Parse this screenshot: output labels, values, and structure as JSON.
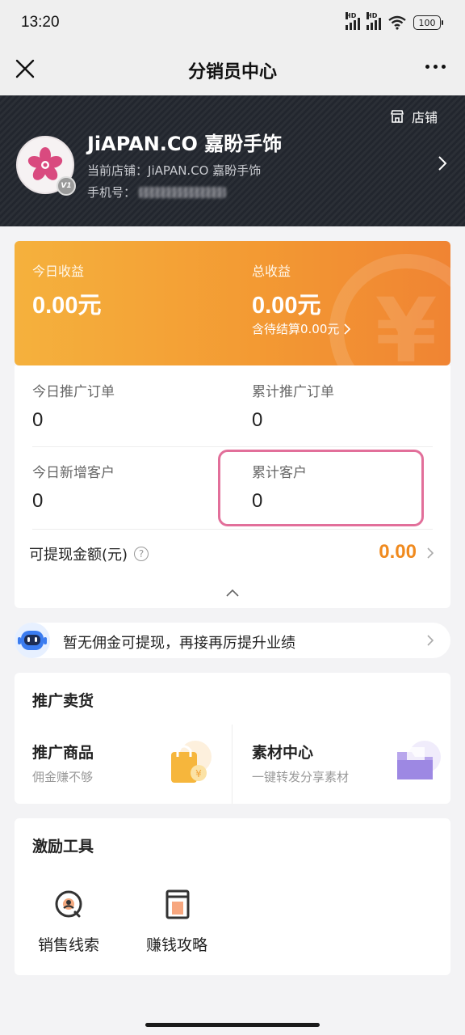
{
  "status_bar": {
    "time": "13:20",
    "signal1_label": "HD",
    "signal2_label": "HD",
    "battery": "100"
  },
  "nav": {
    "title": "分销员中心",
    "close_icon": "close-icon",
    "more_icon": "more-icon"
  },
  "profile": {
    "shop_link_label": "店铺",
    "name": "JiAPAN.CO 嘉盼手饰",
    "level_badge": "V1",
    "current_shop_label": "当前店铺：",
    "current_shop_name": "JiAPAN.CO 嘉盼手饰",
    "phone_label": "手机号："
  },
  "earnings": {
    "today_label": "今日收益",
    "today_value": "0.00元",
    "total_label": "总收益",
    "total_value": "0.00元",
    "pending_text": "含待结算0.00元"
  },
  "stats": {
    "today_orders_label": "今日推广订单",
    "today_orders_value": "0",
    "total_orders_label": "累计推广订单",
    "total_orders_value": "0",
    "today_customers_label": "今日新增客户",
    "today_customers_value": "0",
    "total_customers_label": "累计客户",
    "total_customers_value": "0",
    "withdrawable_label": "可提现金额(元)",
    "withdrawable_value": "0.00"
  },
  "tip": {
    "text": "暂无佣金可提现，再接再厉提升业绩"
  },
  "promo": {
    "title": "推广卖货",
    "items": [
      {
        "title": "推广商品",
        "subtitle": "佣金赚不够"
      },
      {
        "title": "素材中心",
        "subtitle": "一键转发分享素材"
      }
    ]
  },
  "tools": {
    "title": "激励工具",
    "items": [
      {
        "label": "销售线索"
      },
      {
        "label": "赚钱攻略"
      }
    ]
  },
  "colors": {
    "accent_orange": "#f08a1e",
    "card_gradient_start": "#f5b13d",
    "card_gradient_end": "#f08433",
    "profile_bg": "#22262e",
    "highlight": "#e26f9a"
  }
}
